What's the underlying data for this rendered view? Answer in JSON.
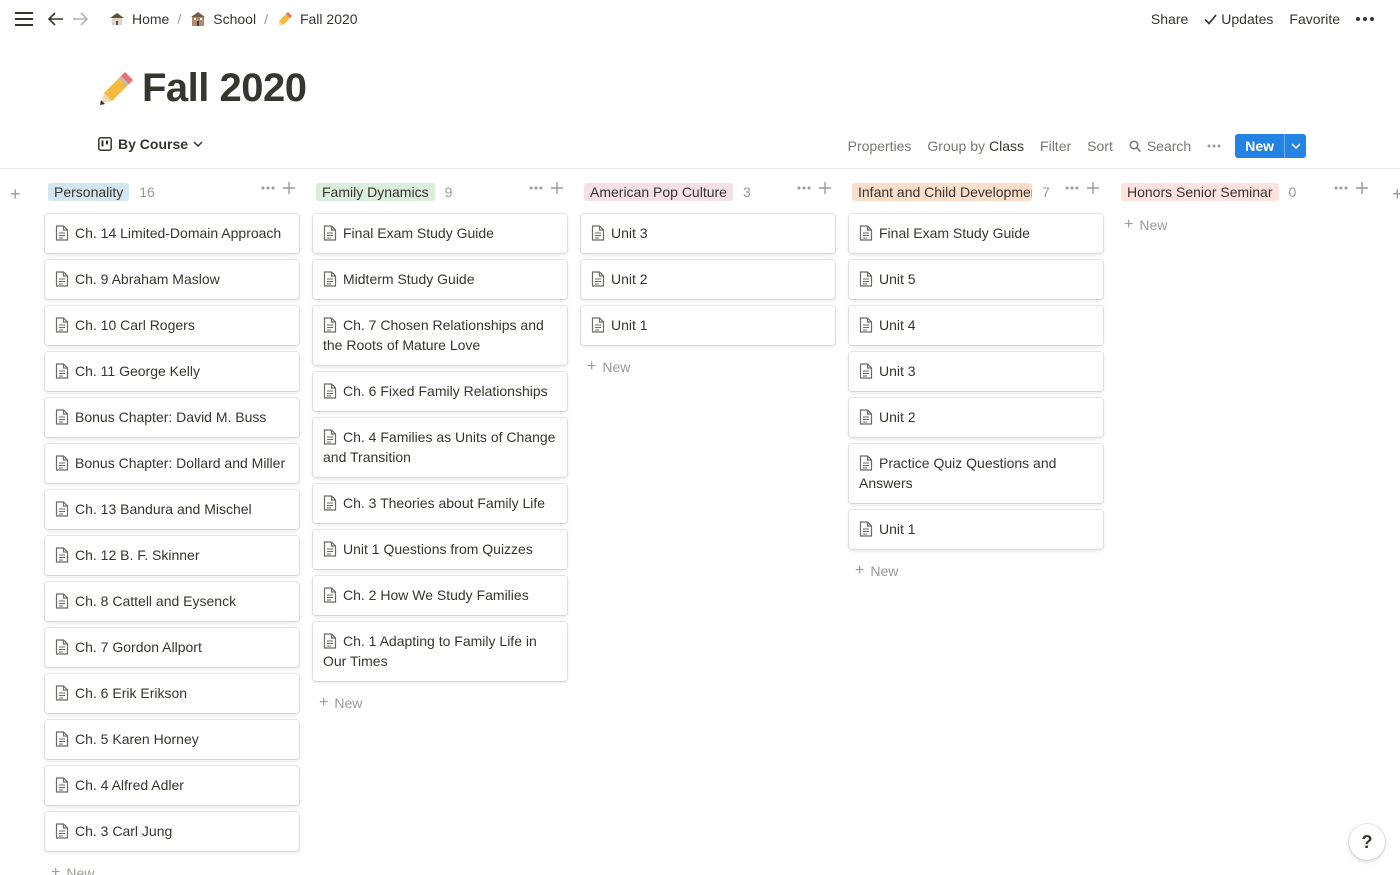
{
  "topbar": {
    "breadcrumbs": [
      {
        "label": "Home",
        "icon": "house-icon"
      },
      {
        "label": "School",
        "icon": "school-icon"
      },
      {
        "label": "Fall 2020",
        "icon": "pencil-icon"
      }
    ],
    "separator": "/",
    "share_label": "Share",
    "updates_label": "Updates",
    "favorite_label": "Favorite"
  },
  "page": {
    "title": "Fall 2020",
    "icon": "pencil-icon"
  },
  "view": {
    "name": "By Course",
    "properties_label": "Properties",
    "group_by_label": "Group by",
    "group_by_value": "Class",
    "filter_label": "Filter",
    "sort_label": "Sort",
    "search_label": "Search",
    "new_label": "New",
    "accent_color": "#2383e2"
  },
  "columns": [
    {
      "name": "Personality",
      "count": "16",
      "color": "#d3e5ef",
      "cards": [
        "Ch. 14 Limited-Domain Approach",
        "Ch. 9 Abraham Maslow",
        "Ch. 10 Carl Rogers",
        "Ch. 11 George Kelly",
        "Bonus Chapter: David M. Buss",
        "Bonus Chapter: Dollard and Miller",
        "Ch. 13 Bandura and Mischel",
        "Ch. 12 B. F. Skinner",
        "Ch. 8 Cattell and Eysenck",
        "Ch. 7 Gordon Allport",
        "Ch. 6 Erik Erikson",
        "Ch. 5 Karen Horney",
        "Ch. 4 Alfred Adler",
        "Ch. 3 Carl Jung"
      ]
    },
    {
      "name": "Family Dynamics",
      "count": "9",
      "color": "#dbeddb",
      "cards": [
        "Final Exam Study Guide",
        "Midterm Study Guide",
        "Ch. 7 Chosen Relationships and the Roots of Mature Love",
        "Ch. 6 Fixed Family Relationships",
        "Ch. 4 Families as Units of Change and Transition",
        "Ch. 3 Theories about Family Life",
        "Unit 1 Questions from Quizzes",
        "Ch. 2 How We Study Families",
        "Ch. 1 Adapting to Family Life in Our Times"
      ]
    },
    {
      "name": "American Pop Culture",
      "count": "3",
      "color": "#f5e0e9",
      "cards": [
        "Unit 3",
        "Unit 2",
        "Unit 1"
      ]
    },
    {
      "name": "Infant and Child Developmer",
      "count": "7",
      "color": "#fadec9",
      "cards": [
        "Final Exam Study Guide",
        "Unit 5",
        "Unit 4",
        "Unit 3",
        "Unit 2",
        "Practice Quiz Questions and Answers",
        "Unit 1"
      ]
    },
    {
      "name": "Honors Senior Seminar",
      "count": "0",
      "color": "#ffe2dd",
      "cards": []
    }
  ],
  "new_row_label": "New",
  "help_label": "?"
}
